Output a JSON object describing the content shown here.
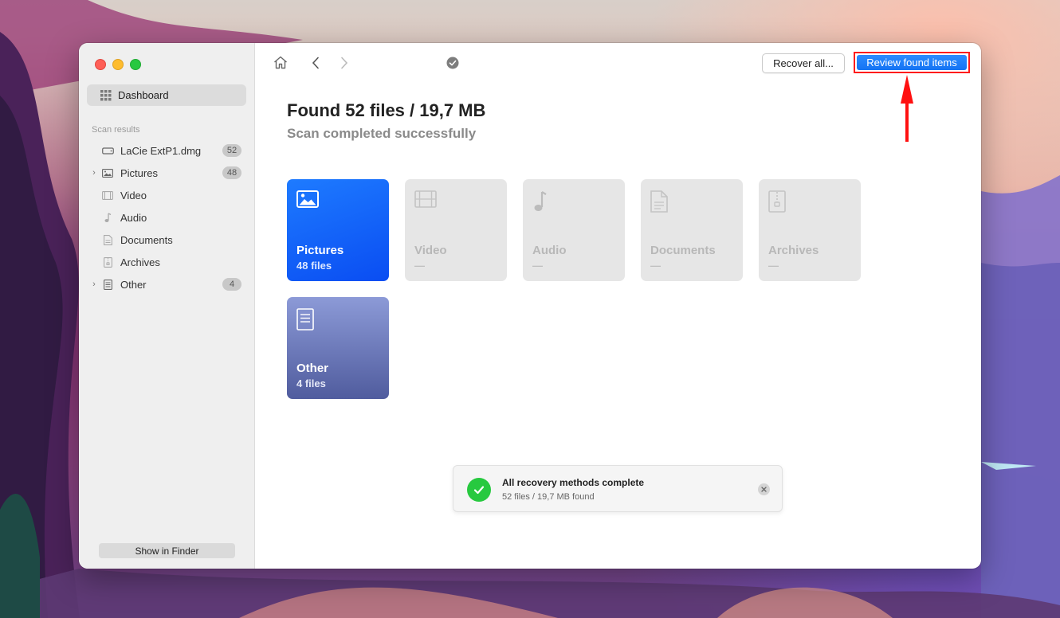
{
  "window": {
    "controls": {
      "close": "#fe5f57",
      "minimize": "#febc2e",
      "zoom": "#28c840"
    }
  },
  "sidebar": {
    "dashboard_label": "Dashboard",
    "section_label": "Scan results",
    "items": [
      {
        "label": "LaCie ExtP1.dmg",
        "badge": "52",
        "icon": "drive-icon",
        "expandable": false
      },
      {
        "label": "Pictures",
        "badge": "48",
        "icon": "image-icon",
        "expandable": true
      },
      {
        "label": "Video",
        "badge": "",
        "icon": "film-icon",
        "expandable": false
      },
      {
        "label": "Audio",
        "badge": "",
        "icon": "music-note-icon",
        "expandable": false
      },
      {
        "label": "Documents",
        "badge": "",
        "icon": "document-icon",
        "expandable": false
      },
      {
        "label": "Archives",
        "badge": "",
        "icon": "archive-icon",
        "expandable": false
      },
      {
        "label": "Other",
        "badge": "4",
        "icon": "file-icon",
        "expandable": true
      }
    ],
    "show_in_finder_label": "Show in Finder"
  },
  "toolbar": {
    "home_icon": "home-icon",
    "back_icon": "chevron-left-icon",
    "forward_icon": "chevron-right-icon",
    "status_icon": "checkmark-circle-icon",
    "recover_all_label": "Recover all...",
    "review_found_label": "Review found items",
    "accent_color": "#1a7cff",
    "highlight_color": "#ff1c1c"
  },
  "main": {
    "title": "Found 52 files / 19,7 MB",
    "subtitle": "Scan completed successfully",
    "tiles": [
      {
        "name": "Pictures",
        "count": "48 files",
        "icon": "image-icon",
        "active": true
      },
      {
        "name": "Video",
        "count": "—",
        "icon": "film-icon",
        "active": false
      },
      {
        "name": "Audio",
        "count": "—",
        "icon": "music-note-icon",
        "active": false
      },
      {
        "name": "Documents",
        "count": "—",
        "icon": "document-icon",
        "active": false
      },
      {
        "name": "Archives",
        "count": "—",
        "icon": "archive-icon",
        "active": false
      },
      {
        "name": "Other",
        "count": "4 files",
        "icon": "file-icon",
        "active": true
      }
    ]
  },
  "toast": {
    "title": "All recovery methods complete",
    "detail": "52 files / 19,7 MB found",
    "icon": "checkmark-icon",
    "close_icon": "close-icon"
  }
}
